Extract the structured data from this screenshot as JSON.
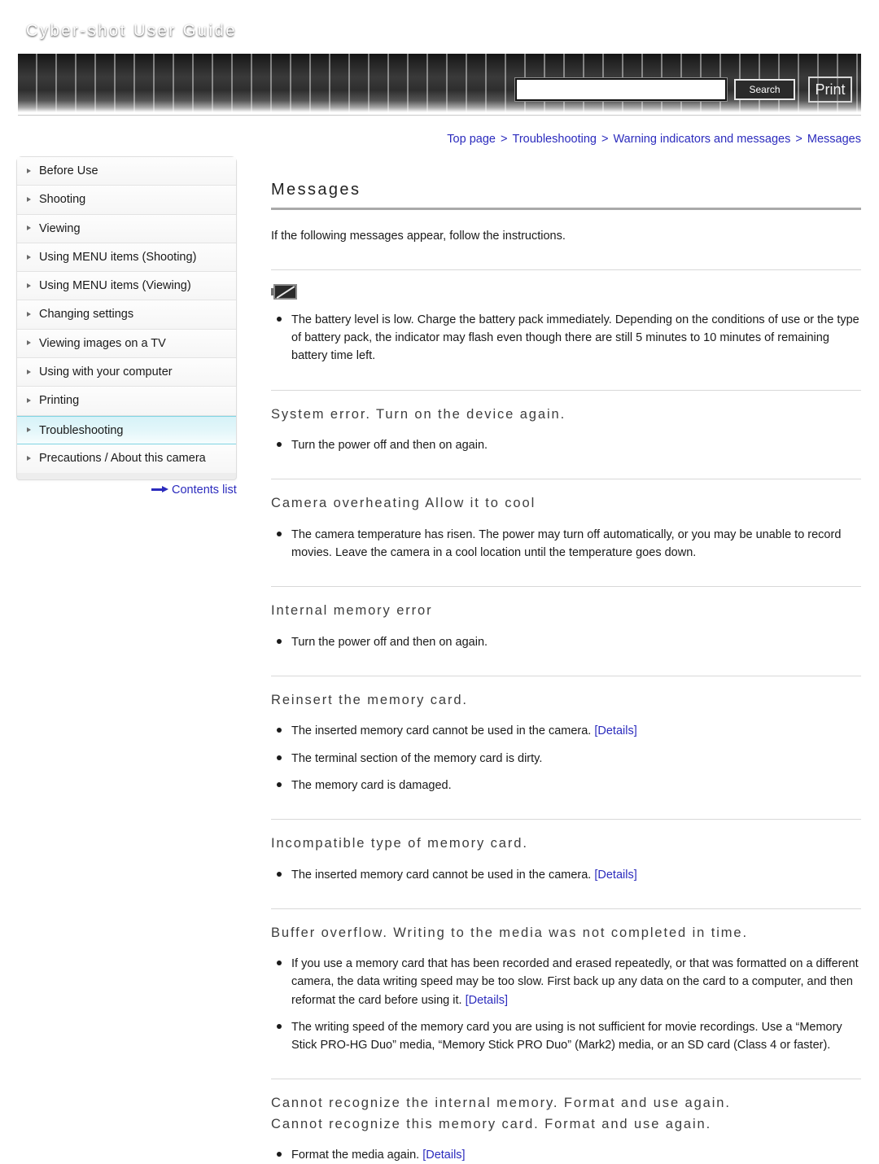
{
  "header": {
    "title": "Cyber-shot User Guide",
    "search_value": "",
    "search_placeholder": "",
    "search_label": "Search",
    "print_label": "Print"
  },
  "breadcrumb": {
    "items": [
      "Top page",
      "Troubleshooting",
      "Warning indicators and messages",
      "Messages"
    ],
    "separator": ">"
  },
  "sidebar": {
    "items": [
      {
        "label": "Before Use",
        "active": false
      },
      {
        "label": "Shooting",
        "active": false
      },
      {
        "label": "Viewing",
        "active": false
      },
      {
        "label": "Using MENU items (Shooting)",
        "active": false
      },
      {
        "label": "Using MENU items (Viewing)",
        "active": false
      },
      {
        "label": "Changing settings",
        "active": false
      },
      {
        "label": "Viewing images on a TV",
        "active": false
      },
      {
        "label": "Using with your computer",
        "active": false
      },
      {
        "label": "Printing",
        "active": false
      },
      {
        "label": "Troubleshooting",
        "active": true
      },
      {
        "label": "Precautions / About this camera",
        "active": false
      }
    ],
    "contents_link": "Contents list"
  },
  "main": {
    "title": "Messages",
    "intro": "If the following messages appear, follow the instructions.",
    "details_label": "[Details]",
    "sections": [
      {
        "icon": "low-battery-icon",
        "heading": "",
        "bullets": [
          {
            "text": "The battery level is low. Charge the battery pack immediately. Depending on the conditions of use or the type of battery pack, the indicator may flash even though there are still 5 minutes to 10 minutes of remaining battery time left.",
            "details": false
          }
        ]
      },
      {
        "heading": "System error. Turn on the device again.",
        "bullets": [
          {
            "text": "Turn the power off and then on again.",
            "details": false
          }
        ]
      },
      {
        "heading": "Camera overheating Allow it to cool",
        "bullets": [
          {
            "text": "The camera temperature has risen. The power may turn off automatically, or you may be unable to record movies. Leave the camera in a cool location until the temperature goes down.",
            "details": false
          }
        ]
      },
      {
        "heading": "Internal memory error",
        "bullets": [
          {
            "text": "Turn the power off and then on again.",
            "details": false
          }
        ]
      },
      {
        "heading": "Reinsert the memory card.",
        "bullets": [
          {
            "text": "The inserted memory card cannot be used in the camera.",
            "details": true
          },
          {
            "text": "The terminal section of the memory card is dirty.",
            "details": false
          },
          {
            "text": "The memory card is damaged.",
            "details": false
          }
        ]
      },
      {
        "heading": "Incompatible type of memory card.",
        "bullets": [
          {
            "text": "The inserted memory card cannot be used in the camera.",
            "details": true
          }
        ]
      },
      {
        "heading": "Buffer overflow. Writing to the media was not completed in time.",
        "bullets": [
          {
            "text": "If you use a memory card that has been recorded and erased repeatedly, or that was formatted on a different camera, the data writing speed may be too slow. First back up any data on the card to a computer, and then reformat the card before using it.",
            "details": true
          },
          {
            "text": "The writing speed of the memory card you are using is not sufficient for movie recordings. Use a “Memory Stick PRO-HG Duo” media, “Memory Stick PRO Duo” (Mark2) media, or an SD card (Class 4 or faster).",
            "details": false
          }
        ]
      },
      {
        "heading": "Cannot recognize the internal memory. Format and use again.\nCannot recognize this memory card. Format and use again.",
        "bullets": [
          {
            "text": "Format the media again.",
            "details": true
          }
        ]
      }
    ]
  },
  "colors": {
    "link": "#2b2bbd",
    "active_nav_bg": "#d6f2f8",
    "active_nav_border": "#7fd3e2",
    "header_dark": "#232323"
  }
}
